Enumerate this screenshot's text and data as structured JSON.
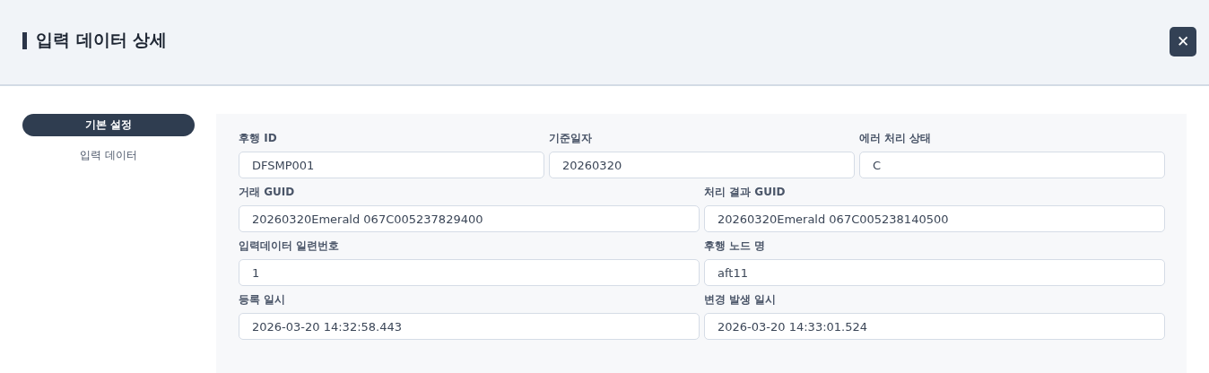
{
  "header": {
    "title": "입력 데이터 상세",
    "close_label": "✕"
  },
  "sidebar": {
    "items": [
      {
        "label": "기본 설정",
        "selected": true
      },
      {
        "label": "입력 데이터",
        "selected": false
      }
    ]
  },
  "form": {
    "rows": [
      {
        "fields": [
          {
            "label": "후행 ID",
            "value": "DFSMP001"
          },
          {
            "label": "기준일자",
            "value": "20260320"
          },
          {
            "label": "에러 처리 상태",
            "value": "C"
          }
        ]
      },
      {
        "fields": [
          {
            "label": "거래 GUID",
            "value": "20260320Emerald 067C005237829400"
          },
          {
            "label": "처리 결과 GUID",
            "value": "20260320Emerald 067C005238140500"
          }
        ]
      },
      {
        "fields": [
          {
            "label": "입력데이터 일련번호",
            "value": "1"
          },
          {
            "label": "후행 노드 명",
            "value": "aft11"
          }
        ]
      },
      {
        "fields": [
          {
            "label": "등록 일시",
            "value": "2026-03-20 14:32:58.443"
          },
          {
            "label": "변경 발생 일시",
            "value": "2026-03-20 14:33:01.524"
          }
        ]
      }
    ]
  }
}
